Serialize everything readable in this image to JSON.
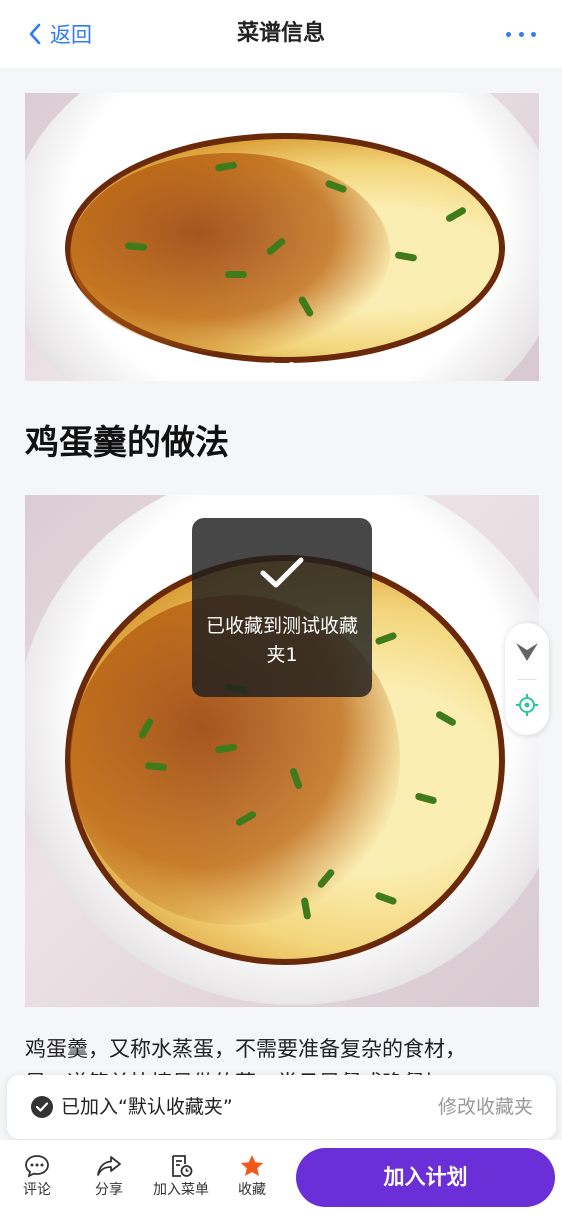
{
  "header": {
    "back_label": "返回",
    "title": "菜谱信息",
    "more_icon": "more-dots-icon"
  },
  "carousel": {
    "total": 2,
    "active_index": 1
  },
  "recipe": {
    "title": "鸡蛋羹的做法",
    "description_line1": "鸡蛋羹，又称水蒸蛋，不需要准备复杂的食材，",
    "description_line2": "是一道简单快捷易做的菜，常见早餐或晚餐加"
  },
  "toast": {
    "icon": "check-icon",
    "message": "已收藏到测试收藏夹1"
  },
  "side_controls": {
    "top_icon": "scroll-to-top-icon",
    "locate_icon": "locate-icon"
  },
  "banner": {
    "icon": "check-circle-icon",
    "added_text": "已加入“默认收藏夹”",
    "modify_label": "修改收藏夹"
  },
  "bottom_bar": {
    "tabs": [
      {
        "label": "评论",
        "icon": "comment-icon"
      },
      {
        "label": "分享",
        "icon": "share-icon"
      },
      {
        "label": "加入菜单",
        "icon": "menu-add-icon"
      },
      {
        "label": "收藏",
        "icon": "star-icon"
      }
    ],
    "plan_button": "加入计划"
  },
  "colors": {
    "accent_blue": "#2f7cf6",
    "plan_purple": "#6a2fd6",
    "star_orange": "#f25a1a",
    "locate_green": "#2ec5a2"
  }
}
